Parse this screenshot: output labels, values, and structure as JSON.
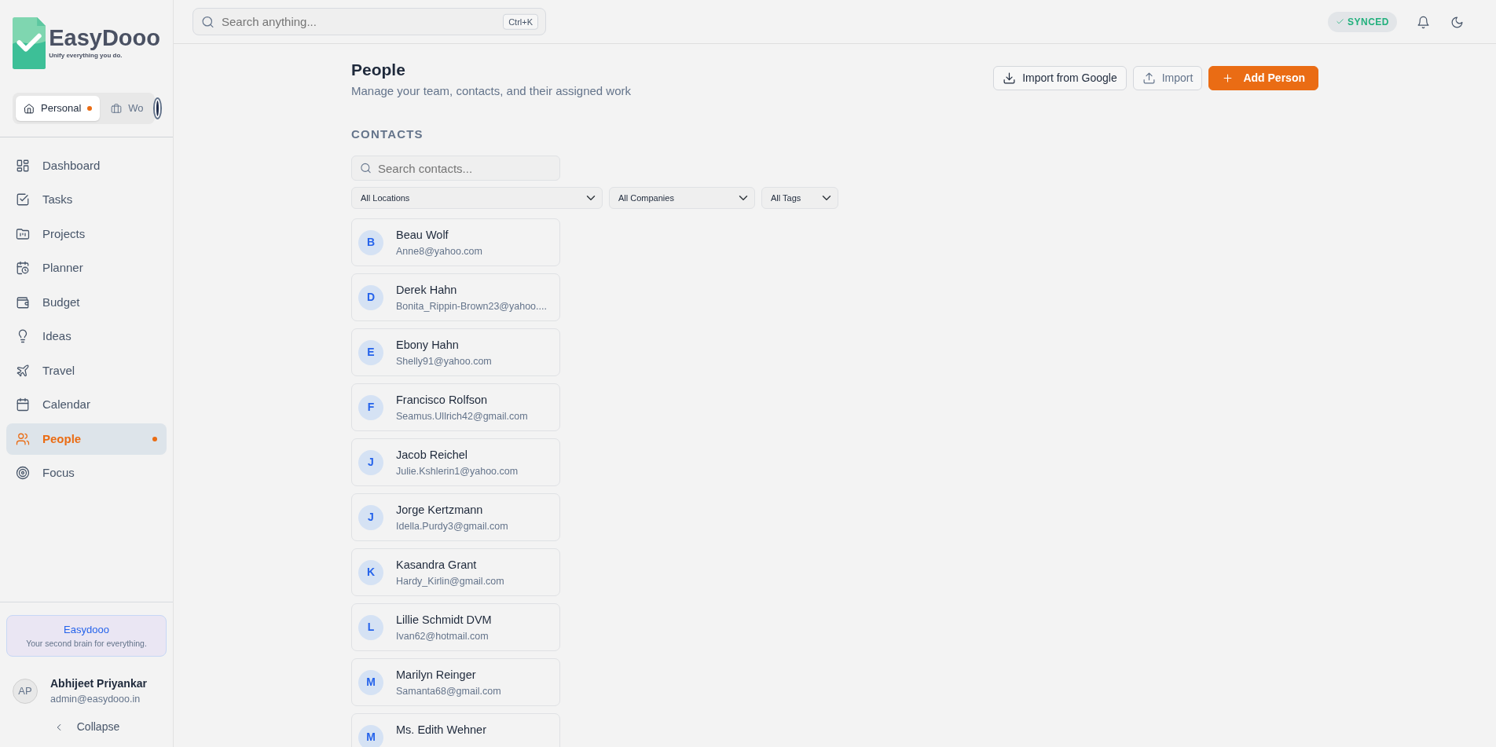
{
  "brand": {
    "name": "EasyDooo",
    "tagline": "Unify everything you do."
  },
  "workspaces": [
    {
      "label": "Personal",
      "selected": true,
      "dot": true
    },
    {
      "label": "Wo",
      "selected": false,
      "dot": false
    }
  ],
  "sidebar": {
    "items": [
      {
        "label": "Dashboard",
        "selected": false,
        "dot": false
      },
      {
        "label": "Tasks",
        "selected": false,
        "dot": false
      },
      {
        "label": "Projects",
        "selected": false,
        "dot": false
      },
      {
        "label": "Planner",
        "selected": false,
        "dot": false
      },
      {
        "label": "Budget",
        "selected": false,
        "dot": false
      },
      {
        "label": "Ideas",
        "selected": false,
        "dot": false
      },
      {
        "label": "Travel",
        "selected": false,
        "dot": false
      },
      {
        "label": "Calendar",
        "selected": false,
        "dot": false
      },
      {
        "label": "People",
        "selected": true,
        "dot": true
      },
      {
        "label": "Focus",
        "selected": false,
        "dot": false
      }
    ],
    "promo": {
      "title": "Easydooo",
      "text": "Your second brain for everything."
    },
    "user": {
      "initials": "AP",
      "name": "Abhijeet Priyankar",
      "email": "admin@easydooo.in"
    },
    "collapse": "Collapse"
  },
  "topbar": {
    "search": {
      "placeholder": "Search anything...",
      "shortcut": "Ctrl+K"
    },
    "sync": "SYNCED"
  },
  "page": {
    "title": "People",
    "subtitle": "Manage your team, contacts, and their assigned work",
    "buttons": [
      {
        "label": "Import from Google",
        "kind": "outline"
      },
      {
        "label": "Import",
        "kind": "muted"
      },
      {
        "label": "Add Person",
        "kind": "primary"
      }
    ]
  },
  "contacts": {
    "heading": "CONTACTS",
    "search": {
      "placeholder": "Search contacts..."
    },
    "filters": [
      "All Locations",
      "All Companies",
      "All Tags"
    ],
    "items": [
      {
        "initial": "B",
        "name": "Beau Wolf",
        "email": "Anne8@yahoo.com"
      },
      {
        "initial": "D",
        "name": "Derek Hahn",
        "email": "Bonita_Rippin-Brown23@yahoo...."
      },
      {
        "initial": "E",
        "name": "Ebony Hahn",
        "email": "Shelly91@yahoo.com"
      },
      {
        "initial": "F",
        "name": "Francisco Rolfson",
        "email": "Seamus.Ullrich42@gmail.com"
      },
      {
        "initial": "J",
        "name": "Jacob Reichel",
        "email": "Julie.Kshlerin1@yahoo.com"
      },
      {
        "initial": "J",
        "name": "Jorge Kertzmann",
        "email": "Idella.Purdy3@gmail.com"
      },
      {
        "initial": "K",
        "name": "Kasandra Grant",
        "email": "Hardy_Kirlin@gmail.com"
      },
      {
        "initial": "L",
        "name": "Lillie Schmidt DVM",
        "email": "Ivan62@hotmail.com"
      },
      {
        "initial": "M",
        "name": "Marilyn Reinger",
        "email": "Samanta68@gmail.com"
      },
      {
        "initial": "M",
        "name": "Ms. Edith Wehner"
      }
    ]
  }
}
